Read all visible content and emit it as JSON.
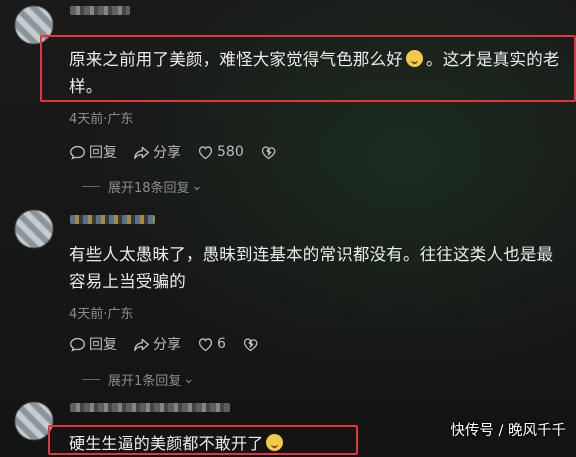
{
  "comments": [
    {
      "text_before_emoji": "原来之前用了美颜，难怪大家觉得气色那么好",
      "text_after_emoji": "。这才是真实的老样。",
      "meta": "4天前·广东",
      "reply_label": "回复",
      "share_label": "分享",
      "like_count": "580",
      "expand_label": "展开18条回复"
    },
    {
      "text": "有些人太愚昧了，愚昧到连基本的常识都没有。往往这类人也是最容易上当受骗的",
      "meta": "4天前·广东",
      "reply_label": "回复",
      "share_label": "分享",
      "like_count": "6",
      "expand_label": "展开1条回复"
    },
    {
      "text": "硬生生逼的美颜都不敢开了"
    }
  ],
  "watermark": "快传号 / 晚风千千",
  "colors": {
    "highlight": "#e2353d",
    "background": "#141414"
  }
}
